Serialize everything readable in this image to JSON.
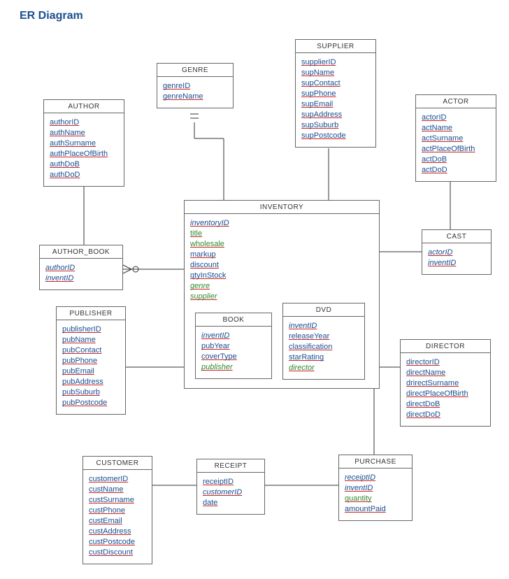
{
  "title": "ER Diagram",
  "entities": {
    "author": {
      "name": "AUTHOR",
      "attrs": [
        "authorID",
        "authName",
        "authSurname",
        "authPlaceOfBirth",
        "authDoB",
        "authDoD"
      ]
    },
    "author_book": {
      "name": "AUTHOR_BOOK",
      "attrs": [
        "authorID",
        "inventID"
      ]
    },
    "genre": {
      "name": "GENRE",
      "attrs": [
        "genreID",
        "genreName"
      ]
    },
    "supplier": {
      "name": "SUPPLIER",
      "attrs": [
        "supplierID",
        "supName",
        "supContact",
        "supPhone",
        "supEmail",
        "supAddress",
        "supSuburb",
        "supPostcode"
      ]
    },
    "actor": {
      "name": "ACTOR",
      "attrs": [
        "actorID",
        "actName",
        "actSurname",
        "actPlaceOfBirth",
        "actDoB",
        "actDoD"
      ]
    },
    "cast": {
      "name": "CAST",
      "attrs": [
        "actorID",
        "inventID"
      ]
    },
    "inventory": {
      "name": "INVENTORY",
      "attrs": [
        "inventoryID",
        "title",
        "wholesale",
        "markup",
        "discount",
        "qtyInStock",
        "genre",
        "supplier"
      ]
    },
    "book": {
      "name": "BOOK",
      "attrs": [
        "inventID",
        "pubYear",
        "coverType",
        "publisher"
      ]
    },
    "dvd": {
      "name": "DVD",
      "attrs": [
        "inventID",
        "releaseYear",
        "classification",
        "starRating",
        "director"
      ]
    },
    "publisher": {
      "name": "PUBLISHER",
      "attrs": [
        "publisherID",
        "pubName",
        "pubContact",
        "pubPhone",
        "pubEmail",
        "pubAddress",
        "pubSuburb",
        "pubPostcode"
      ]
    },
    "director": {
      "name": "DIRECTOR",
      "attrs": [
        "directorID",
        "directName",
        "drirectSurname",
        "directPlaceOfBirth",
        "directDoB",
        "directDoD"
      ]
    },
    "customer": {
      "name": "CUSTOMER",
      "attrs": [
        "customerID",
        "custName",
        "custSurname",
        "custPhone",
        "custEmail",
        "custAddress",
        "custPostcode",
        "custDiscount"
      ]
    },
    "receipt": {
      "name": "RECEIPT",
      "attrs": [
        "receiptID",
        "customerID",
        "date"
      ]
    },
    "purchase": {
      "name": "PURCHASE",
      "attrs": [
        "receiptID",
        "inventID",
        "quantity",
        "amountPaid"
      ]
    }
  }
}
